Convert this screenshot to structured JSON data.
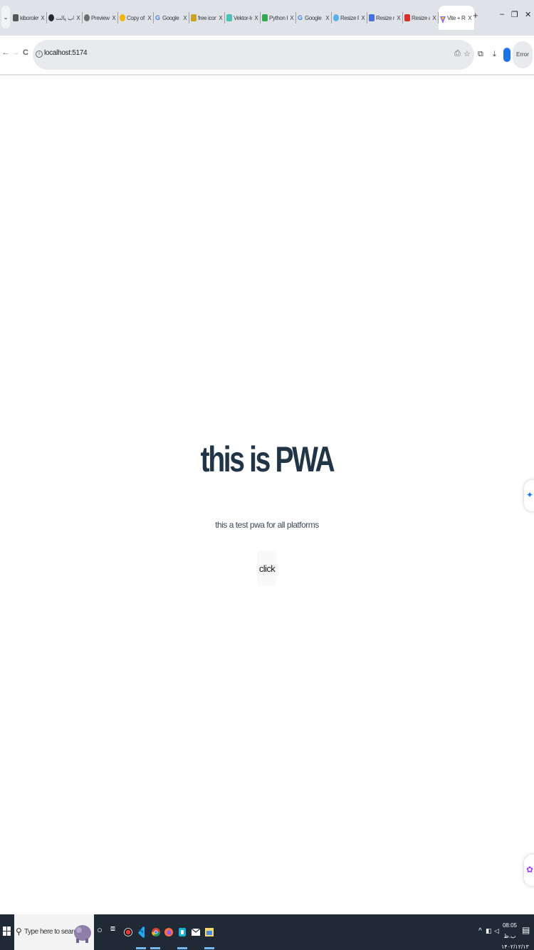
{
  "browser": {
    "tabs": [
      {
        "title": "kiborolevens",
        "icon": "kibo-icon"
      },
      {
        "title": "انتخاب پالت",
        "icon": "github-icon"
      },
      {
        "title": "Preview an",
        "icon": "preview-icon"
      },
      {
        "title": "Copy of ch",
        "icon": "copy-icon"
      },
      {
        "title": "Google",
        "icon": "google-icon"
      },
      {
        "title": "free icons",
        "icon": "free-icons-icon"
      },
      {
        "title": "Vektor-Ico",
        "icon": "vektor-icon"
      },
      {
        "title": "Python Ico",
        "icon": "python-icon"
      },
      {
        "title": "Google",
        "icon": "google-icon"
      },
      {
        "title": "Resize PW",
        "icon": "resize-pwa-icon"
      },
      {
        "title": "Resize ma",
        "icon": "resize-icon"
      },
      {
        "title": "Resize a P",
        "icon": "resize-icon"
      },
      {
        "title": "Vite + Rea",
        "icon": "vite-icon",
        "active": true
      }
    ],
    "tab_close_glyph": "X",
    "new_tab_glyph": "+",
    "window_controls": {
      "minimize": "–",
      "restore": "❐",
      "close": "✕"
    },
    "nav": {
      "back": "←",
      "forward": "→",
      "reload": "C"
    },
    "url": "localhost:5174",
    "profile_initial": "",
    "error_label": "Error"
  },
  "page": {
    "title": "this is PWA",
    "subtitle": "this a test pwa for all platforms",
    "button_label": "click"
  },
  "taskbar": {
    "search_placeholder": "Type here to search",
    "apps": [
      "cortana-icon",
      "task-view-icon",
      "recorder-icon",
      "vscode-icon",
      "chrome-icon",
      "firefox-icon",
      "app-icon",
      "mail-icon",
      "file-explorer-icon"
    ],
    "clock_time": "08:05 ب.ظ",
    "clock_date": "۱۴۰۲/۱۲/۱۳",
    "tray_up": "^"
  },
  "colors": {
    "tab_strip": "#dfe3e8",
    "title": "#213547",
    "taskbar": "#1f2a36",
    "accent": "#1a73e8"
  }
}
